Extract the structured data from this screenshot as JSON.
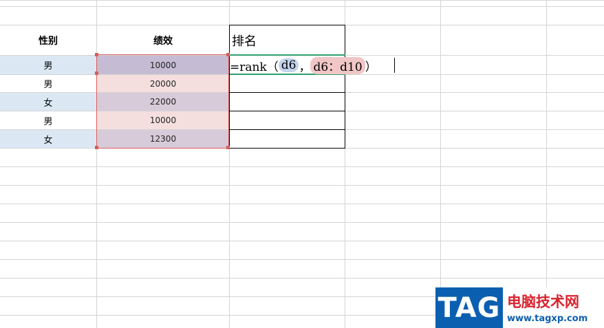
{
  "headers": {
    "gender": "性别",
    "performance": "绩效",
    "rank": "排名"
  },
  "rows": [
    {
      "gender": "男",
      "performance": "10000"
    },
    {
      "gender": "男",
      "performance": "20000"
    },
    {
      "gender": "女",
      "performance": "22000"
    },
    {
      "gender": "男",
      "performance": "10000"
    },
    {
      "gender": "女",
      "performance": "12300"
    }
  ],
  "formula": {
    "prefix": "=rank（",
    "ref1": "d6",
    "separator": "，",
    "ref2": "d6：d10",
    "suffix": "）"
  },
  "watermark": {
    "logo": "TAG",
    "site_name": "电脑技术网",
    "url": "www.tagxp.com"
  },
  "colors": {
    "selection_border": "#d95c5c",
    "active_green": "#2e9e6e",
    "gender_fill": "#dbe8f4"
  }
}
